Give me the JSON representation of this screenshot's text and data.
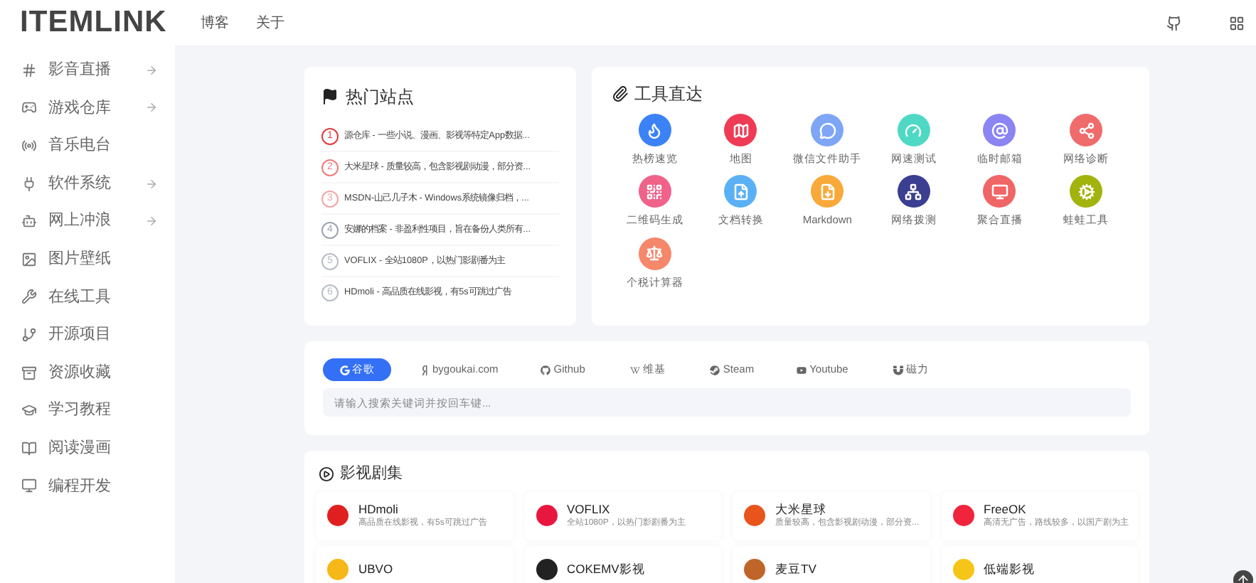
{
  "logo": "ITEMLINK",
  "nav": [
    "博客",
    "关于"
  ],
  "sidebar": {
    "items": [
      {
        "label": "影音直播",
        "has_arrow": true
      },
      {
        "label": "游戏仓库",
        "has_arrow": true
      },
      {
        "label": "音乐电台",
        "has_arrow": false
      },
      {
        "label": "软件系统",
        "has_arrow": true
      },
      {
        "label": "网上冲浪",
        "has_arrow": true
      },
      {
        "label": "图片壁纸",
        "has_arrow": false
      },
      {
        "label": "在线工具",
        "has_arrow": false
      },
      {
        "label": "开源项目",
        "has_arrow": false
      },
      {
        "label": "资源收藏",
        "has_arrow": false
      },
      {
        "label": "学习教程",
        "has_arrow": false
      },
      {
        "label": "阅读漫画",
        "has_arrow": false
      },
      {
        "label": "编程开发",
        "has_arrow": false
      }
    ]
  },
  "hot_sites": {
    "title": "热门站点",
    "items": [
      {
        "rank": "1",
        "text": "源仓库 - 一些小说、漫画、影视等特定App数据...",
        "color": "#e03c3c"
      },
      {
        "rank": "2",
        "text": "大米星球 - 质量较高，包含影视剧动漫，部分资...",
        "color": "#ee7b7b"
      },
      {
        "rank": "3",
        "text": "MSDN-山己几子木 - Windows系统镜像归档，...",
        "color": "#f3a6a6"
      },
      {
        "rank": "4",
        "text": "安娜的档案 - 非盈利性项目，旨在备份人类所有...",
        "color": "#9ca3af"
      },
      {
        "rank": "5",
        "text": "VOFLIX - 全站1080P，以热门影剧番为主",
        "color": "#b8bcc4"
      },
      {
        "rank": "6",
        "text": "HDmoli - 高品质在线影视，有5s可跳过广告",
        "color": "#b8bcc4"
      }
    ]
  },
  "tools": {
    "title": "工具直达",
    "items": [
      {
        "label": "热榜速览",
        "color": "#3b82f6"
      },
      {
        "label": "地图",
        "color": "#ef3b55"
      },
      {
        "label": "微信文件助手",
        "color": "#7ea6f5"
      },
      {
        "label": "网速测试",
        "color": "#4fd9c4"
      },
      {
        "label": "临时邮箱",
        "color": "#8b84f3"
      },
      {
        "label": "网络诊断",
        "color": "#f06b6b"
      },
      {
        "label": "二维码生成",
        "color": "#f0628a"
      },
      {
        "label": "文档转换",
        "color": "#5ab0f5"
      },
      {
        "label": "Markdown",
        "color": "#f8a93a"
      },
      {
        "label": "网络拨测",
        "color": "#3b3f91"
      },
      {
        "label": "聚合直播",
        "color": "#f06565"
      },
      {
        "label": "蛙蛙工具",
        "color": "#a3b30e"
      },
      {
        "label": "个税计算器",
        "color": "#f5876b"
      }
    ]
  },
  "search": {
    "tabs": [
      {
        "label": "谷歌",
        "selected": true
      },
      {
        "label": "bygoukai.com",
        "selected": false
      },
      {
        "label": "Github",
        "selected": false
      },
      {
        "label": "维基",
        "selected": false
      },
      {
        "label": "Steam",
        "selected": false
      },
      {
        "label": "Youtube",
        "selected": false
      },
      {
        "label": "磁力",
        "selected": false
      }
    ],
    "placeholder": "请输入搜索关键词并按回车键..."
  },
  "movies": {
    "title": "影视剧集",
    "items": [
      {
        "name": "HDmoli",
        "desc": "高品质在线影视，有5s可跳过广告",
        "color": "#e02020"
      },
      {
        "name": "VOFLIX",
        "desc": "全站1080P，以热门影剧番为主",
        "color": "#e8173f"
      },
      {
        "name": "大米星球",
        "desc": "质量较高，包含影视剧动漫，部分资...",
        "color": "#e8541c"
      },
      {
        "name": "FreeOK",
        "desc": "高清无广告，路线较多，以国产剧为主",
        "color": "#f0243c"
      },
      {
        "name": "UBVO",
        "color": "#f5b818"
      },
      {
        "name": "COKEMV影视",
        "color": "#222222"
      },
      {
        "name": "麦豆TV",
        "color": "#c0652a"
      },
      {
        "name": "低端影视",
        "color": "#f5c518"
      }
    ]
  }
}
